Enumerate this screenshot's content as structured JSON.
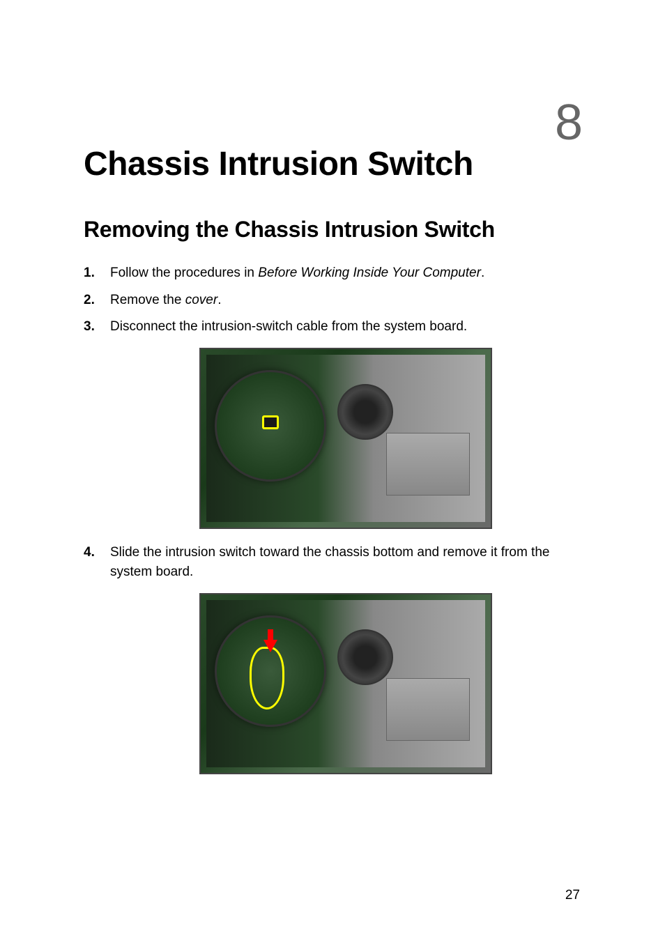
{
  "chapter": {
    "number": "8",
    "title": "Chassis Intrusion Switch"
  },
  "section": {
    "heading": "Removing the Chassis Intrusion Switch"
  },
  "steps": {
    "s1_pre": "Follow the procedures in ",
    "s1_link": "Before Working Inside Your Computer",
    "s1_post": ".",
    "s2_pre": "Remove the ",
    "s2_link": "cover",
    "s2_post": ".",
    "s3": "Disconnect the intrusion-switch cable from the system board.",
    "s4": "Slide the intrusion switch toward the chassis bottom and remove it from the system board."
  },
  "page_number": "27"
}
